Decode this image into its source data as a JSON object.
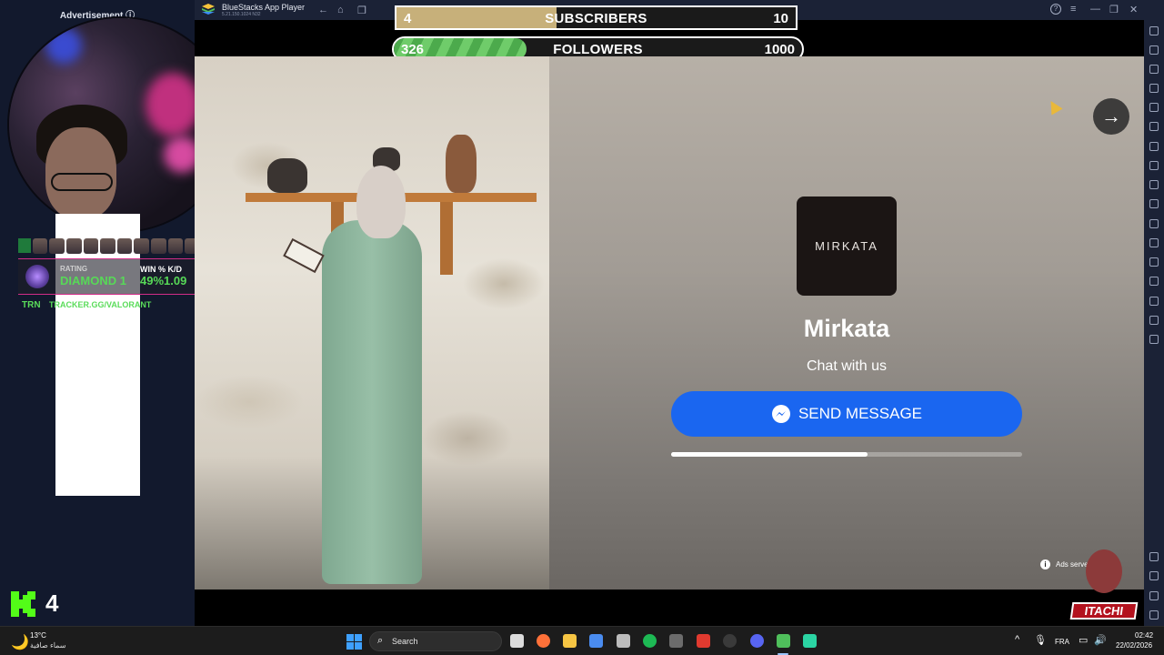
{
  "stream_overlay": {
    "advertisement_label": "Advertisement ⓘ",
    "rank_card": {
      "rating_label": "RATING",
      "rating_value": "DIAMOND 1",
      "win_kd_label": "WIN % K/D",
      "win_kd_value": "49%1.09",
      "tracker_logo": "TRN",
      "tracker_url": "TRACKER.GG/VALORANT"
    },
    "kick_viewers": "4",
    "brand_badge": "ITACHI"
  },
  "goals": {
    "subscribers": {
      "current": "4",
      "title": "SUBSCRIBERS",
      "target": "10",
      "progress": 0.4
    },
    "followers": {
      "current": "326",
      "title": "FOLLOWERS",
      "target": "1000",
      "progress": 0.326
    }
  },
  "bluestacks": {
    "title": "BlueStacks App Player",
    "version": "5.21.150.1024 N32",
    "nav": {
      "back": "←",
      "home": "⌂",
      "multi": "❐"
    },
    "window_controls": {
      "help": "?",
      "menu": "≡",
      "minimize": "—",
      "maximize": "❐",
      "close": "✕"
    }
  },
  "ad": {
    "brand_logo_text": "MIRKATA",
    "brand_name": "Mirkata",
    "subtitle": "Chat with us",
    "cta_label": "SEND MESSAGE",
    "progress": 0.56,
    "next_arrow": "→",
    "info_icon": "i",
    "served_by": "Ads served by Meta"
  },
  "taskbar": {
    "weather_icon": "🌙",
    "temperature": "13°C",
    "weather_desc": "سماء صافية",
    "search_icon": "⌕",
    "search_placeholder": "Search",
    "tray": {
      "chevron": "^",
      "language": "FRA",
      "mic": "🎙",
      "network": "▭",
      "volume": "🔊",
      "time": "02:42",
      "date": "22/02/2026"
    }
  },
  "colors": {
    "messenger_blue": "#1a66f0",
    "follow_green": "#5cbb58",
    "sub_gold": "#c7b07a",
    "rating_green": "#57d957"
  }
}
